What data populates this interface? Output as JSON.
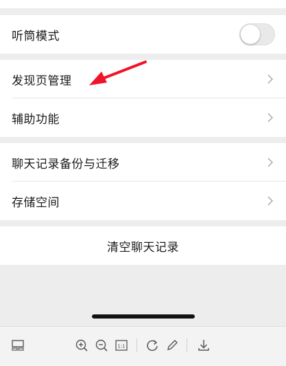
{
  "settings": {
    "earpiece_mode": {
      "label": "听筒模式",
      "enabled": false
    },
    "discover_manage": {
      "label": "发现页管理"
    },
    "accessibility": {
      "label": "辅助功能"
    },
    "chat_backup": {
      "label": "聊天记录备份与迁移"
    },
    "storage": {
      "label": "存储空间"
    },
    "clear_chat": {
      "label": "清空聊天记录"
    }
  },
  "colors": {
    "background": "#ededed",
    "cell": "#ffffff",
    "arrow": "#f0142a",
    "toolbar": "#f3f3f3"
  },
  "toolbar": {
    "icons": [
      "thumbnail-icon",
      "zoom-in-icon",
      "zoom-out-icon",
      "actual-size-icon",
      "rotate-icon",
      "edit-pen-icon",
      "download-icon"
    ],
    "actual_size_label": "1:1"
  }
}
